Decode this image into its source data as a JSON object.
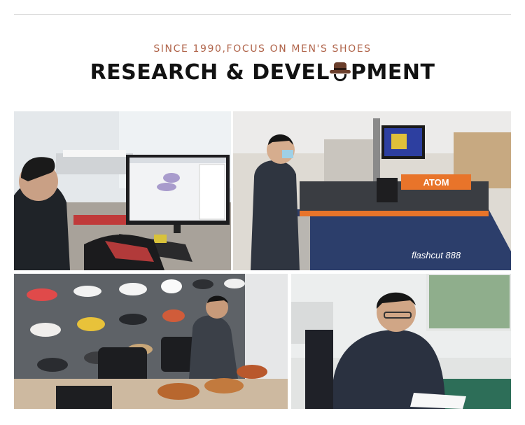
{
  "header": {
    "tagline": "SINCE 1990,FOCUS ON MEN'S SHOES",
    "title_before_logo": "RESEARCH & DEVEL",
    "title_after_logo": "PMENT"
  },
  "photos": [
    {
      "subject": "designer-at-computer"
    },
    {
      "subject": "cutting-machine"
    },
    {
      "subject": "shoe-wall-inspection"
    },
    {
      "subject": "worker-writing"
    }
  ],
  "machine": {
    "brand_label": "ATOM",
    "model_label": "flashcut 888"
  },
  "colors": {
    "tagline": "#b0644a",
    "title": "#121212",
    "hat": "#6b3f2c",
    "machine_accent": "#e8742a"
  }
}
